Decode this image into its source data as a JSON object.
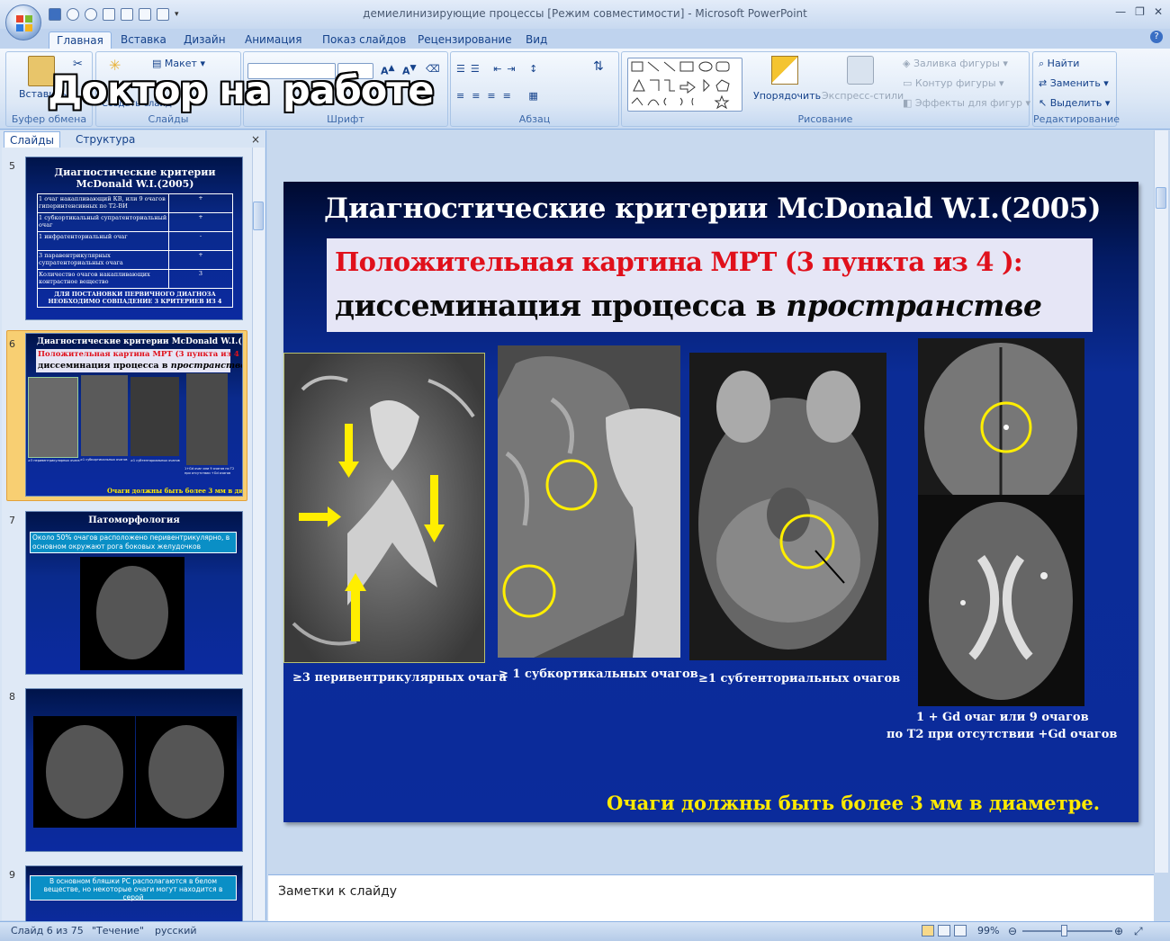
{
  "window": {
    "title": "демиелинизирующие процессы [Режим совместимости] - Microsoft PowerPoint",
    "controls": [
      "—",
      "❐",
      "✕"
    ]
  },
  "ribbon_tabs": [
    "Главная",
    "Вставка",
    "Дизайн",
    "Анимация",
    "Показ слайдов",
    "Рецензирование",
    "Вид"
  ],
  "ribbon": {
    "clipboard": {
      "label": "Буфер обмена",
      "paste": "Вставить"
    },
    "slides": {
      "label": "Слайды",
      "layout": "Макет",
      "create": "Создать слайд"
    },
    "font": {
      "label": "Шрифт"
    },
    "paragraph": {
      "label": "Абзац"
    },
    "drawing": {
      "label": "Рисование",
      "arrange": "Упорядочить",
      "quick_styles": "Экспресс-стили",
      "fill": "Заливка фигуры",
      "outline": "Контур фигуры",
      "effects": "Эффекты для фигур"
    },
    "editing": {
      "label": "Редактирование",
      "find": "Найти",
      "replace": "Заменить",
      "select": "Выделить"
    }
  },
  "watermark": "Доктор на работе",
  "panel": {
    "tabs": [
      "Слайды",
      "Структура"
    ],
    "close": "×"
  },
  "thumbnails": [
    {
      "num": "5",
      "title": "Диагностические критерии McDonald W.I.(2005)",
      "rows": [
        [
          "1 очаг накапливающий КВ, или 9 очагов гиперинтенсивных по Т2-ВИ",
          "+"
        ],
        [
          "1 субкортикальный супратенториальный очаг",
          "+"
        ],
        [
          "1 инфратенториальный очаг",
          "-"
        ],
        [
          "3 паравентрикулярных супратенториальных очага",
          "+"
        ],
        [
          "Количество очагов накапливающих контрастное вещество",
          "3"
        ]
      ],
      "footer": "ДЛЯ ПОСТАНОВКИ ПЕРВИЧНОГО ДИАГНОЗА НЕОБХОДИМО СОВПАДЕНИЕ 3 КРИТЕРИЕВ ИЗ 4"
    },
    {
      "num": "6",
      "title": "Диагностические критерии McDonald W.I.(2005)",
      "line1": "Положительная картина МРТ (3 пункта из 4 ):",
      "line2": "диссеминация процесса в ",
      "line2i": "пространстве",
      "caps": [
        "≥3 перивентрикулярных очага",
        "≥1 субкортикальных очагов",
        "≥1 субтенториальных очагов",
        "1+Gd очаг или 9 очагов по Т2 при отсутствии +Gd очагов"
      ],
      "foot": "Очаги должны быть более 3 мм в диаметре."
    },
    {
      "num": "7",
      "title": "Патоморфология",
      "box": "Около 50% очагов расположено перивентрикулярно, в основном окружают рога боковых желудочков"
    },
    {
      "num": "8"
    },
    {
      "num": "9",
      "box": "В основном бляшки РС располагаются в белом веществе, но некоторые очаги могут находится в серой"
    }
  ],
  "slide": {
    "title": "Диагностические критерии McDonald W.I.(2005)",
    "highlight_line1": "Положительная картина МРТ (3 пункта из 4 ):",
    "highlight_line2": "диссеминация процесса в ",
    "highlight_line2_italic": "пространстве",
    "captions": [
      "≥3 перивентрикулярных очага",
      "≥ 1 субкортикальных очагов",
      "≥1 субтенториальных очагов",
      "1 + Gd очаг или  9  очагов",
      "по Т2  при отсутствии +Gd очагов"
    ],
    "footnote": "Очаги должны быть более 3 мм в диаметре."
  },
  "notes": {
    "placeholder": "Заметки к слайду"
  },
  "status": {
    "slide": "Слайд 6 из 75",
    "theme": "\"Течение\"",
    "lang": "русский",
    "zoom": "99%"
  },
  "colors": {
    "accent_red": "#e0101b",
    "accent_yellow": "#ffea00",
    "slide_blue": "#0b2b9b",
    "ribbon": "#dde8f6"
  }
}
